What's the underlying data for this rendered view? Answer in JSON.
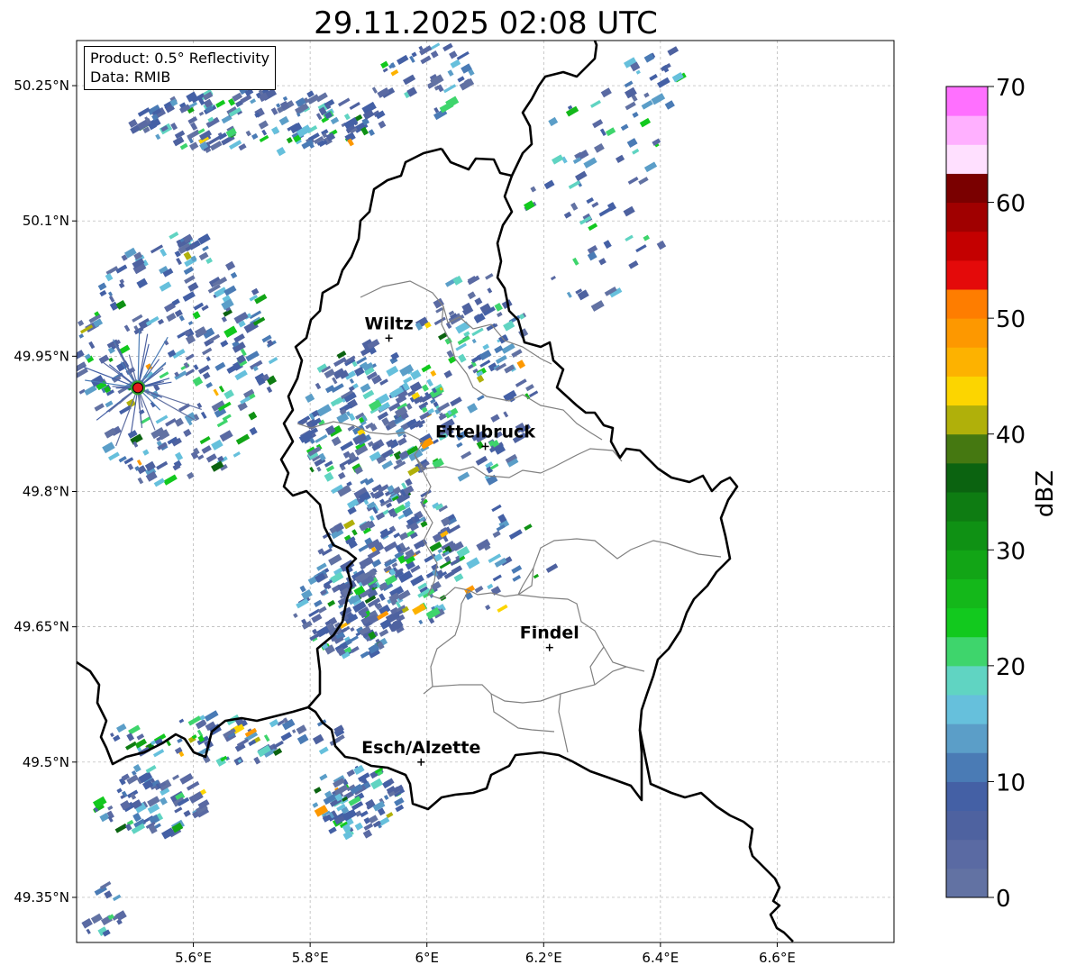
{
  "title": "29.11.2025 02:08 UTC",
  "info": {
    "product": "Product: 0.5° Reflectivity",
    "data_source": "Data: RMIB"
  },
  "axes": {
    "x_ticks": [
      {
        "value": 5.6,
        "label": "5.6°E"
      },
      {
        "value": 5.8,
        "label": "5.8°E"
      },
      {
        "value": 6.0,
        "label": "6°E"
      },
      {
        "value": 6.2,
        "label": "6.2°E"
      },
      {
        "value": 6.4,
        "label": "6.4°E"
      },
      {
        "value": 6.6,
        "label": "6.6°E"
      }
    ],
    "y_ticks": [
      {
        "value": 50.25,
        "label": "50.25°N"
      },
      {
        "value": 50.1,
        "label": "50.1°N"
      },
      {
        "value": 49.95,
        "label": "49.95°N"
      },
      {
        "value": 49.8,
        "label": "49.8°N"
      },
      {
        "value": 49.65,
        "label": "49.65°N"
      },
      {
        "value": 49.5,
        "label": "49.5°N"
      },
      {
        "value": 49.35,
        "label": "49.35°N"
      }
    ],
    "lon_range": [
      5.4,
      6.8
    ],
    "lat_range": [
      49.3,
      50.3
    ],
    "grid": true
  },
  "cities": [
    {
      "name": "Wiltz",
      "lon": 5.935,
      "lat": 49.97
    },
    {
      "name": "Ettelbruck",
      "lon": 6.1,
      "lat": 49.85
    },
    {
      "name": "Findel",
      "lon": 6.21,
      "lat": 49.627
    },
    {
      "name": "Esch/Alzette",
      "lon": 5.99,
      "lat": 49.5
    }
  ],
  "radar_site": {
    "lon": 5.505,
    "lat": 49.915,
    "color": "#e31a1c"
  },
  "colorbar": {
    "label": "dBZ",
    "min": 0,
    "max": 70,
    "step": 2.5,
    "ticks": [
      {
        "value": 0,
        "label": "0"
      },
      {
        "value": 10,
        "label": "10"
      },
      {
        "value": 20,
        "label": "20"
      },
      {
        "value": 30,
        "label": "30"
      },
      {
        "value": 40,
        "label": "40"
      },
      {
        "value": 50,
        "label": "50"
      },
      {
        "value": 60,
        "label": "60"
      },
      {
        "value": 70,
        "label": "70"
      }
    ],
    "colors": [
      "#6272a3",
      "#5a6aa3",
      "#4e62a0",
      "#4460a5",
      "#4a7bb5",
      "#5b9ec8",
      "#66c0dc",
      "#60d4c2",
      "#3ed56c",
      "#12c91e",
      "#14b81a",
      "#12a516",
      "#0f9114",
      "#0e7c12",
      "#0b6310",
      "#457811",
      "#b0b00a",
      "#fcd500",
      "#fdb200",
      "#fd9800",
      "#fe7d00",
      "#e40a0a",
      "#c40000",
      "#a00000",
      "#7a0000",
      "#ffe0ff",
      "#ffb0ff",
      "#ff70ff",
      "#e83ae8"
    ]
  }
}
